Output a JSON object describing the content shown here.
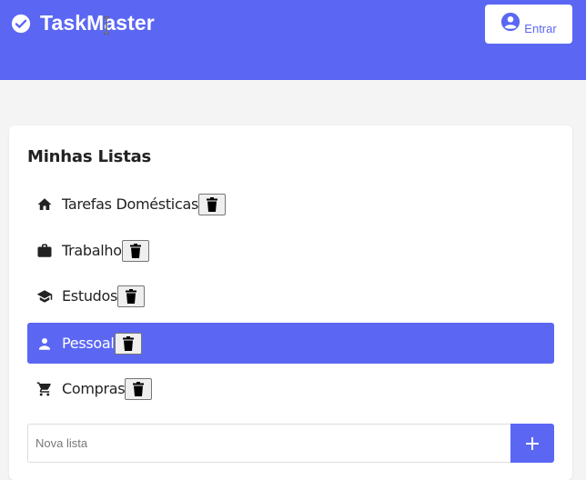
{
  "app": {
    "title": "TaskMaster",
    "brand_icon": "check-circle-icon",
    "accent_color": "#5b67f3"
  },
  "header": {
    "login_label": "Entrar",
    "login_icon": "account-circle-icon"
  },
  "lists": {
    "title": "Minhas Listas",
    "items": [
      {
        "label": "Tarefas Domésticas",
        "icon": "home-icon",
        "active": false
      },
      {
        "label": "Trabalho",
        "icon": "briefcase-icon",
        "active": false
      },
      {
        "label": "Estudos",
        "icon": "graduation-cap-icon",
        "active": false
      },
      {
        "label": "Pessoal",
        "icon": "person-icon",
        "active": true
      },
      {
        "label": "Compras",
        "icon": "cart-icon",
        "active": false
      }
    ],
    "delete_icon": "trash-icon"
  },
  "new_list": {
    "placeholder": "Nova lista",
    "value": "",
    "add_icon": "plus-icon"
  }
}
